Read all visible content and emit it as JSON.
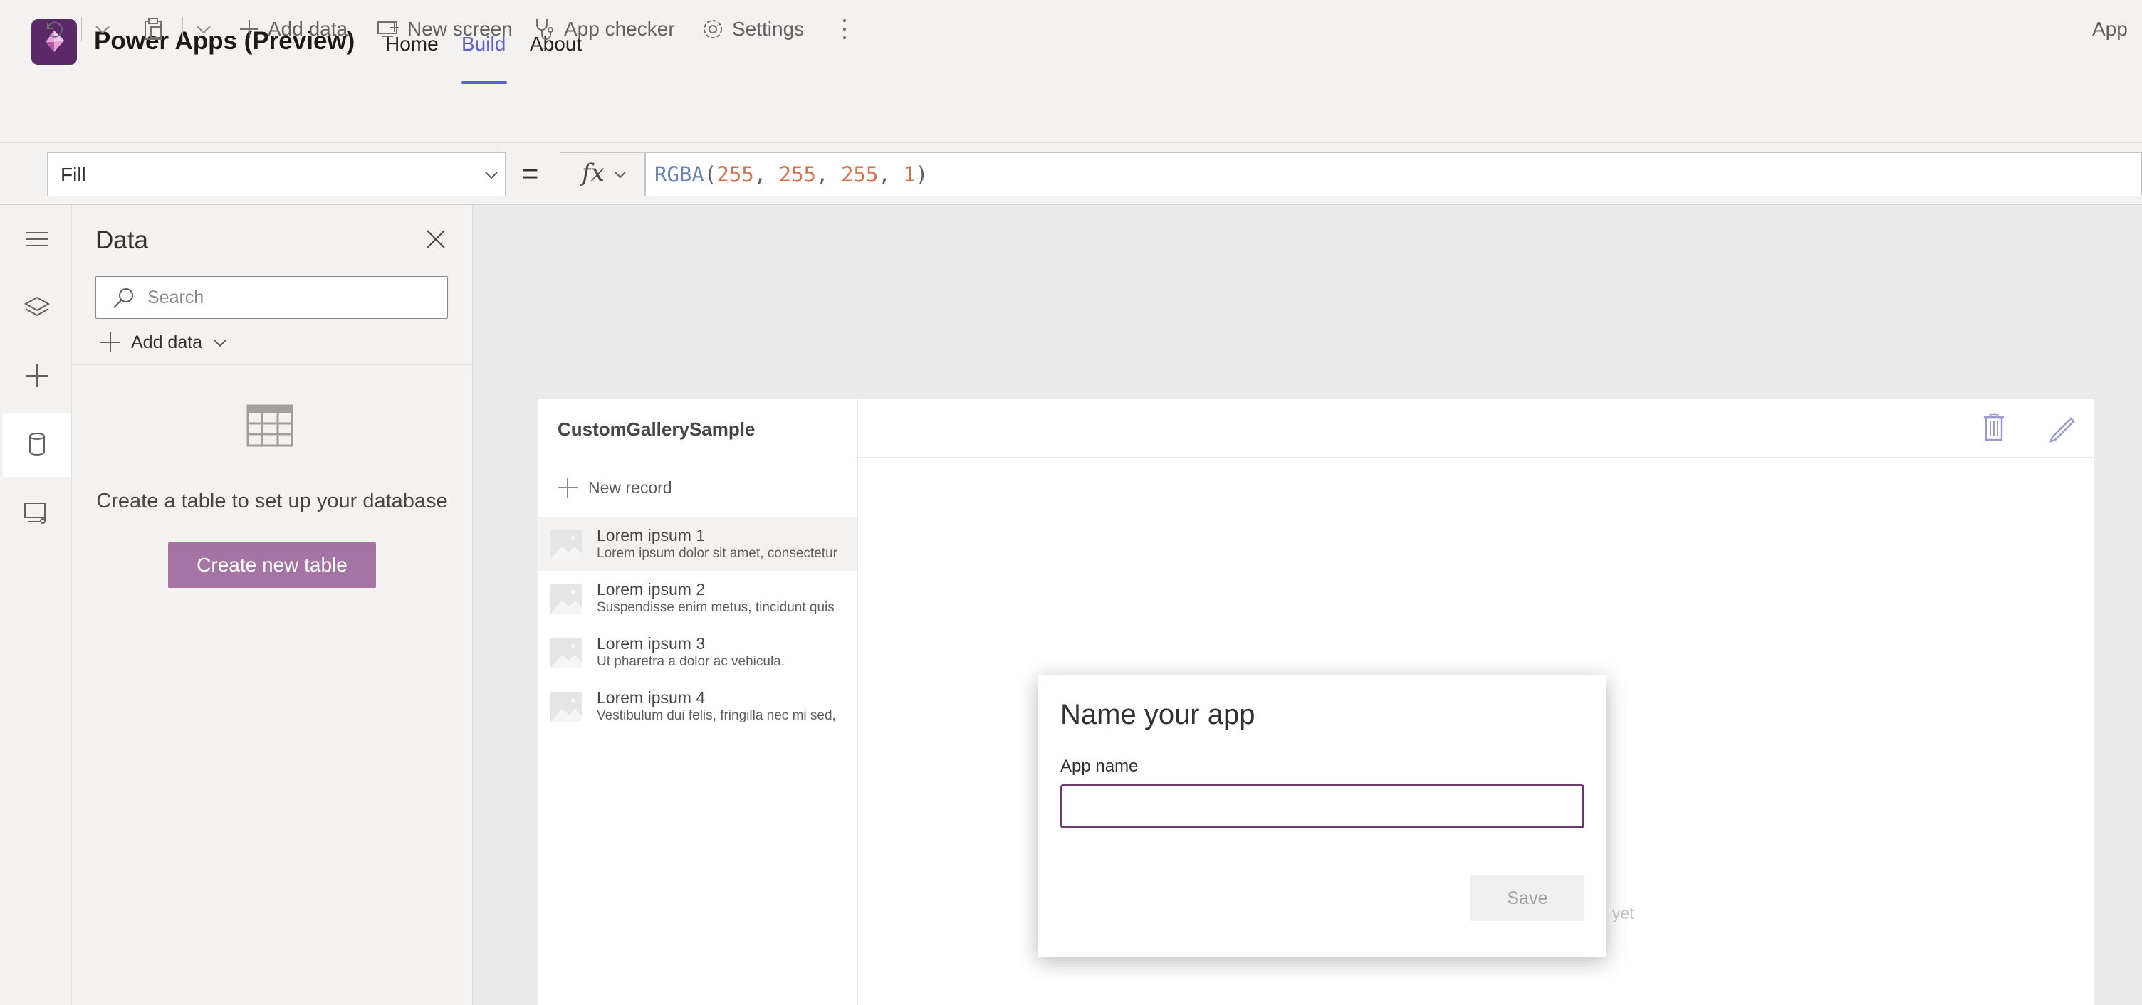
{
  "app": {
    "title": "Power Apps (Preview)",
    "brand_color": "#5b2a66",
    "accent_color": "#5b5fc7"
  },
  "nav": {
    "tabs": [
      {
        "label": "Home",
        "active": false
      },
      {
        "label": "Build",
        "active": true
      },
      {
        "label": "About",
        "active": false
      }
    ]
  },
  "toolbar": {
    "undo_icon": "undo-icon",
    "paste_icon": "clipboard-icon",
    "add_data": "Add data",
    "new_screen": "New screen",
    "app_checker": "App checker",
    "settings": "Settings",
    "more_icon": "more-vertical-icon",
    "right_label": "App"
  },
  "formula_bar": {
    "property": "Fill",
    "equals": "=",
    "fx_label": "fx",
    "formula": {
      "fn": "RGBA",
      "open": "(",
      "a": "255",
      "comma1": ", ",
      "b": "255",
      "comma2": ", ",
      "c": "255",
      "comma3": ", ",
      "d": "1",
      "close": ")"
    }
  },
  "left_rail": {
    "items": [
      {
        "icon": "hamburger-icon",
        "active": false
      },
      {
        "icon": "layers-icon",
        "active": false
      },
      {
        "icon": "plus-icon",
        "active": false
      },
      {
        "icon": "database-icon",
        "active": true
      },
      {
        "icon": "media-icon",
        "active": false
      }
    ]
  },
  "data_panel": {
    "title": "Data",
    "search_placeholder": "Search",
    "add_data": "Add data",
    "empty_message": "Create a table to set up your database",
    "create_button": "Create new table"
  },
  "gallery": {
    "title": "CustomGallerySample",
    "new_record": "New record",
    "items": [
      {
        "title": "Lorem ipsum 1",
        "subtitle": "Lorem ipsum dolor sit amet, consectetur",
        "selected": true
      },
      {
        "title": "Lorem ipsum 2",
        "subtitle": "Suspendisse enim metus, tincidunt quis",
        "selected": false
      },
      {
        "title": "Lorem ipsum 3",
        "subtitle": "Ut pharetra a dolor ac vehicula.",
        "selected": false
      },
      {
        "title": "Lorem ipsum 4",
        "subtitle": "Vestibulum dui felis, fringilla nec mi sed,",
        "selected": false
      }
    ],
    "faded_text": "yet"
  },
  "dialog": {
    "title": "Name your app",
    "label": "App name",
    "input_value": "",
    "save_button": "Save"
  }
}
